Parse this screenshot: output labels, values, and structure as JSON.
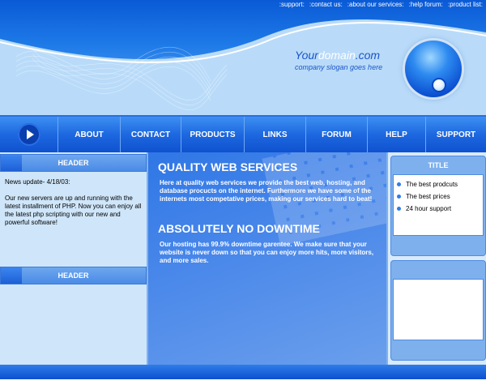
{
  "top_links": [
    ":support:",
    ":contact us:",
    ":about our services:",
    ":help forum:",
    ":product list:"
  ],
  "brand": {
    "your": "Your",
    "domain": "domain",
    "com": ".com",
    "slogan": "company slogan goes here"
  },
  "nav": {
    "items": [
      "ABOUT",
      "CONTACT",
      "PRODUCTS",
      "LINKS",
      "FORUM",
      "HELP",
      "SUPPORT"
    ]
  },
  "left": {
    "header1": "HEADER",
    "news_date": "News update- 4/18/03:",
    "news_body": "Our new servers are up and running with the latest installment of PHP. Now you can enjoy all the latest php scripting with our new and powerful software!",
    "header2": "HEADER"
  },
  "main": {
    "heading1": "QUALITY WEB SERVICES",
    "para1": "Here at quality web services we provide the best web, hosting, and database procucts on the internet. Furthermore we have some of the internets most competative prices, making our services hard to beat!",
    "heading2": "ABSOLUTELY NO DOWNTIME",
    "para2": "Our hosting has 99.9% downtime garentee. We make sure that your website is never down so that you can enjoy more hits, more visitors, and more sales."
  },
  "right": {
    "title": "TITLE",
    "items": [
      "The best prodcuts",
      "The best prices",
      "24 hour support"
    ]
  },
  "colors": {
    "primary": "#1d68e0",
    "light": "#cfe6fa",
    "accent": "#1b55c9"
  }
}
